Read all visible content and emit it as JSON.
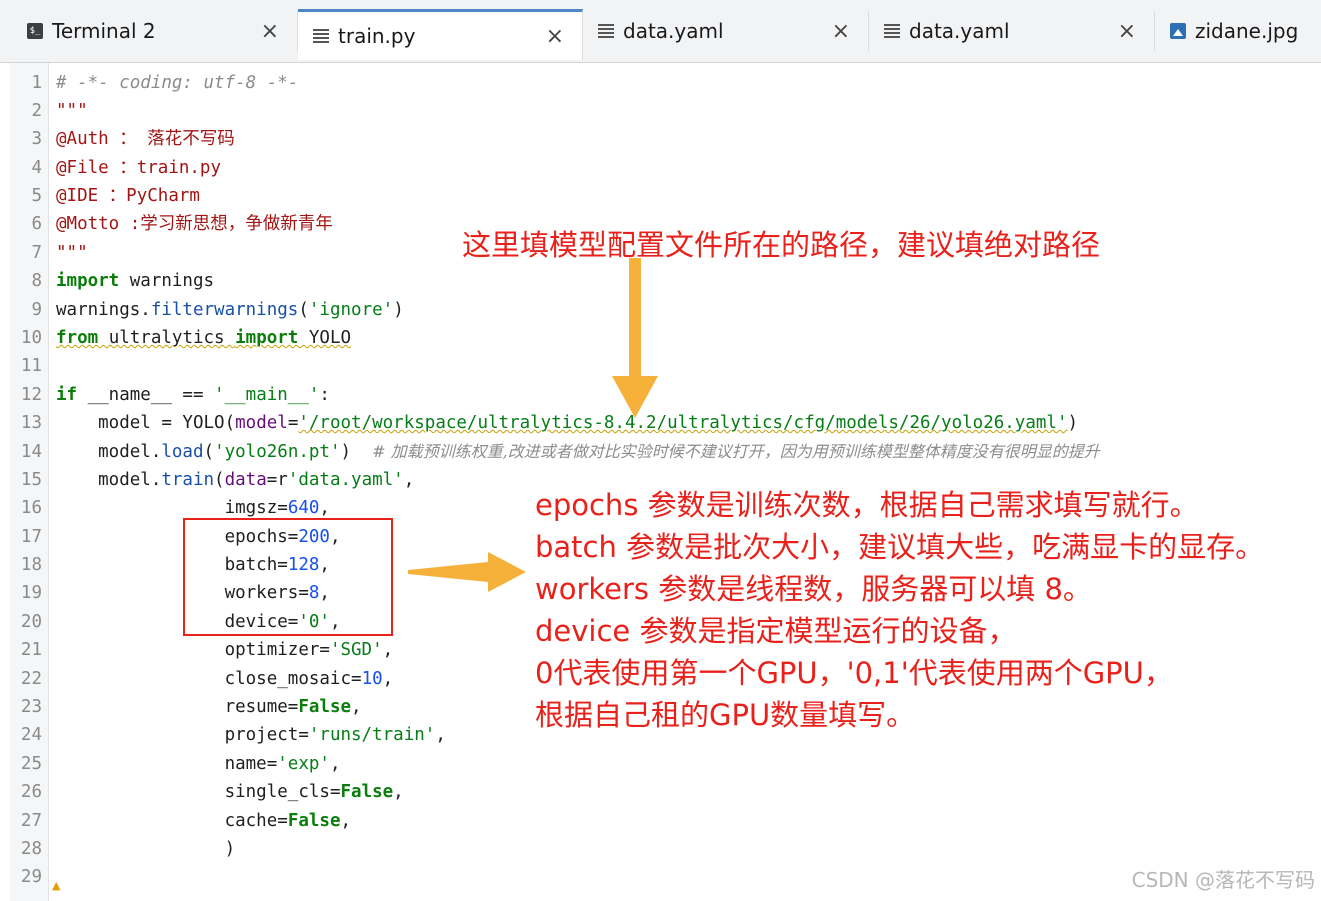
{
  "tabs": [
    {
      "label": "Terminal 2",
      "icon": "terminal-icon",
      "active": false
    },
    {
      "label": "train.py",
      "icon": "python-file-icon",
      "active": true
    },
    {
      "label": "data.yaml",
      "icon": "yaml-file-icon",
      "active": false
    },
    {
      "label": "data.yaml",
      "icon": "yaml-file-icon",
      "active": false
    },
    {
      "label": "zidane.jpg",
      "icon": "image-file-icon",
      "active": false
    }
  ],
  "tab_close_glyph": "×",
  "code_lines": [
    {
      "n": "1"
    },
    {
      "n": "2"
    },
    {
      "n": "3"
    },
    {
      "n": "4"
    },
    {
      "n": "5"
    },
    {
      "n": "6"
    },
    {
      "n": "7"
    },
    {
      "n": "8"
    },
    {
      "n": "9"
    },
    {
      "n": "10"
    },
    {
      "n": "11"
    },
    {
      "n": "12"
    },
    {
      "n": "13"
    },
    {
      "n": "14"
    },
    {
      "n": "15"
    },
    {
      "n": "16"
    },
    {
      "n": "17"
    },
    {
      "n": "18"
    },
    {
      "n": "19"
    },
    {
      "n": "20"
    },
    {
      "n": "21"
    },
    {
      "n": "22"
    },
    {
      "n": "23"
    },
    {
      "n": "24"
    },
    {
      "n": "25"
    },
    {
      "n": "26"
    },
    {
      "n": "27"
    },
    {
      "n": "28"
    },
    {
      "n": "29"
    }
  ],
  "code": {
    "l1": "# -*- coding: utf-8 -*-",
    "l2": "\"\"\"",
    "l3": "@Auth ： 落花不写码",
    "l4": "@File ：train.py",
    "l5": "@IDE ：PyCharm",
    "l6": "@Motto :学习新思想，争做新青年",
    "l7": "\"\"\"",
    "l8a": "import",
    "l8b": " warnings",
    "l9a": "warnings.",
    "l9b": "filterwarnings",
    "l9c": "(",
    "l9d": "'ignore'",
    "l9e": ")",
    "l10a": "from",
    "l10b": " ultralytics ",
    "l10c": "import",
    "l10d": " YOLO",
    "l12a": "if",
    "l12b": " __name__ == ",
    "l12c": "'__main__'",
    "l12d": ":",
    "l13a": "    model = YOLO(",
    "l13b": "model",
    "l13c": "=",
    "l13d": "'/root/workspace/ultralytics-8.4.2/ultralytics/cfg/models/26/yolo26.yaml'",
    "l13e": ")",
    "l14a": "    model.",
    "l14b": "load",
    "l14c": "(",
    "l14d": "'yolo26n.pt'",
    "l14e": ")  ",
    "l14f": "# 加载预训练权重,改进或者做对比实验时候不建议打开，因为用预训练模型整体精度没有很明显的提升",
    "l15a": "    model.",
    "l15b": "train",
    "l15c": "(",
    "l15d": "data",
    "l15e": "=r",
    "l15f": "'data.yaml'",
    "l15g": ",",
    "l16a": "                imgsz",
    "l16b": "=",
    "l16c": "640",
    "l16d": ",",
    "l17a": "                epochs",
    "l17b": "=",
    "l17c": "200",
    "l17d": ",",
    "l18a": "                batch",
    "l18b": "=",
    "l18c": "128",
    "l18d": ",",
    "l19a": "                workers",
    "l19b": "=",
    "l19c": "8",
    "l19d": ",",
    "l20a": "                device",
    "l20b": "=",
    "l20c": "'0'",
    "l20d": ",",
    "l21a": "                optimizer",
    "l21b": "=",
    "l21c": "'SGD'",
    "l21d": ",",
    "l22a": "                close_mosaic",
    "l22b": "=",
    "l22c": "10",
    "l22d": ",",
    "l23a": "                resume",
    "l23b": "=",
    "l23c": "False",
    "l23d": ",",
    "l24a": "                project",
    "l24b": "=",
    "l24c": "'runs/train'",
    "l24d": ",",
    "l25a": "                name",
    "l25b": "=",
    "l25c": "'exp'",
    "l25d": ",",
    "l26a": "                single_cls",
    "l26b": "=",
    "l26c": "False",
    "l26d": ",",
    "l27a": "                cache",
    "l27b": "=",
    "l27c": "False",
    "l27d": ",",
    "l28": "                )"
  },
  "annotations": {
    "top": "这里填模型配置文件所在的路径，建议填绝对路径",
    "block": [
      "epochs 参数是训练次数，根据自己需求填写就行。",
      "batch 参数是批次大小，建议填大些，吃满显卡的显存。",
      "workers 参数是线程数，服务器可以填 8。",
      "device 参数是指定模型运行的设备，",
      "0代表使用第一个GPU，'0,1'代表使用两个GPU，",
      "根据自己租的GPU数量填写。"
    ]
  },
  "watermark": "CSDN @落花不写码",
  "colors": {
    "annotation": "#e8211b",
    "arrow": "#f6b13a",
    "active_tab_accent": "#4a88c7"
  }
}
